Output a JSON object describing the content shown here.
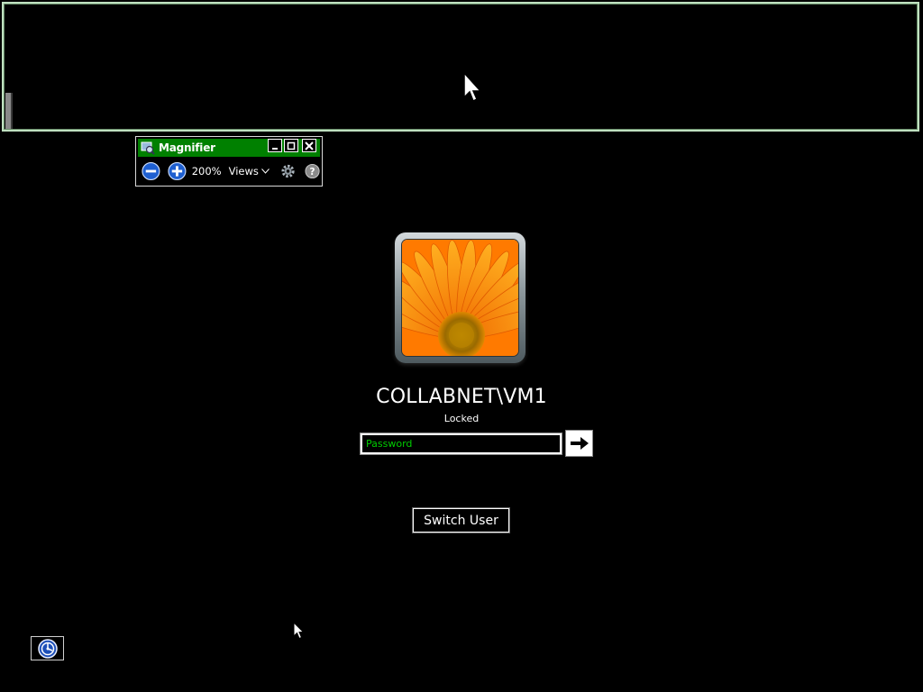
{
  "magnifier": {
    "title": "Magnifier",
    "zoom_level": "200%",
    "views_label": "Views",
    "icons": {
      "app": "magnifier-app-icon",
      "minimize": "minimize-icon",
      "maximize": "maximize-icon",
      "close": "close-icon",
      "zoom_out": "minus-circle-icon",
      "zoom_in": "plus-circle-icon",
      "views_dropdown": "chevron-down-icon",
      "options": "gear-icon",
      "help": "question-icon"
    }
  },
  "login": {
    "username": "COLLABNET\\VM1",
    "status": "Locked",
    "password_placeholder": "Password",
    "submit_icon": "arrow-right-icon",
    "switch_user_label": "Switch User",
    "avatar": "orange-flower-avatar"
  },
  "ease_of_access": {
    "icon": "ease-of-access-icon"
  },
  "colors": {
    "background": "#000000",
    "magnifier_titlebar": "#008000",
    "password_text": "#00cc00",
    "lens_border": "#bfe0c0"
  }
}
